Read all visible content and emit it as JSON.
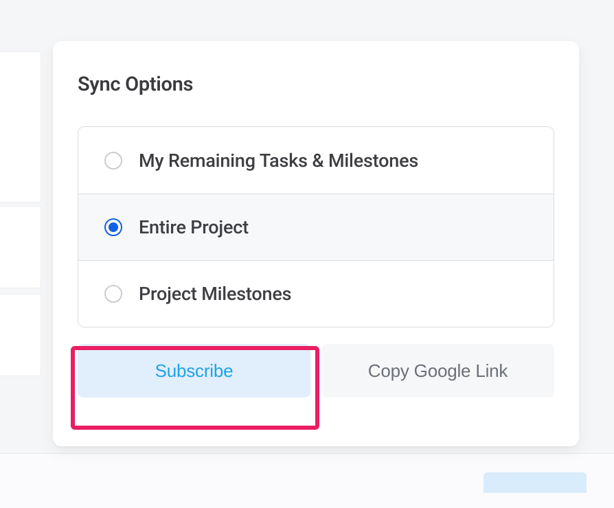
{
  "panel": {
    "title": "Sync Options",
    "options": [
      {
        "label": "My Remaining Tasks & Milestones",
        "selected": false
      },
      {
        "label": "Entire Project",
        "selected": true
      },
      {
        "label": "Project Milestones",
        "selected": false
      }
    ],
    "buttons": {
      "subscribe": "Subscribe",
      "copy": "Copy Google Link"
    }
  }
}
